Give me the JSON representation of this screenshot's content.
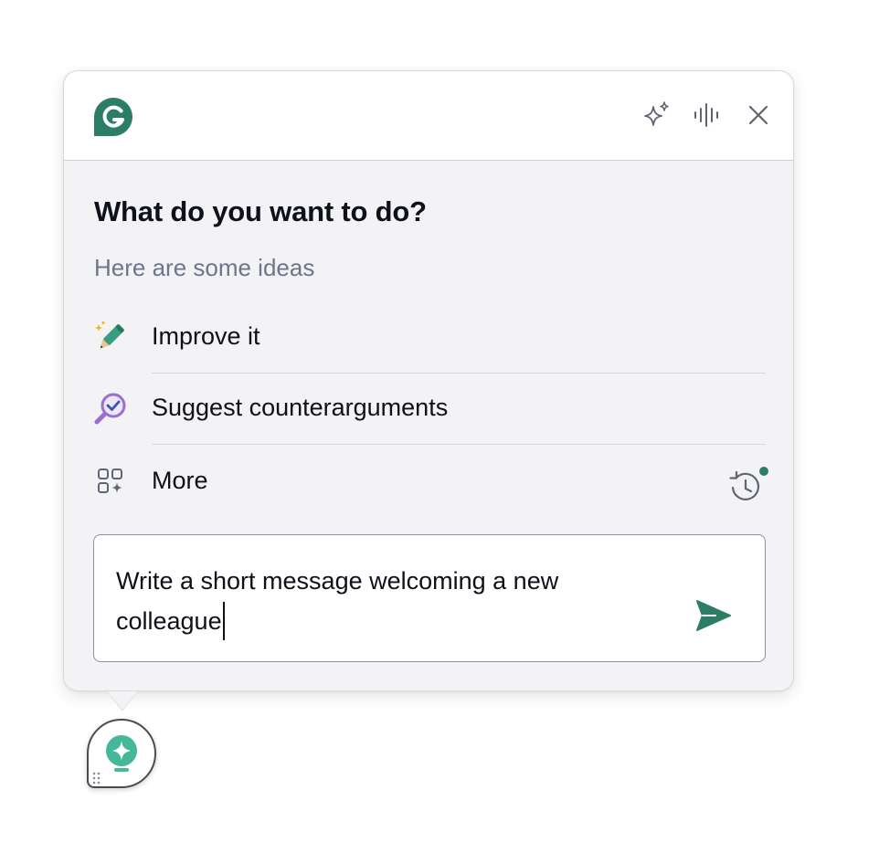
{
  "window": {
    "logo_icon": "grammarly-logo-icon",
    "brand_color": "#2c7d66",
    "header_icons": [
      "sparkle-icon",
      "voice-waveform-icon",
      "close-icon"
    ]
  },
  "prompt_panel": {
    "heading": "What do you want to do?",
    "subheading": "Here are some ideas",
    "ideas": [
      {
        "label": "Improve it",
        "icon": "magic-pencil-icon"
      },
      {
        "label": "Suggest counterarguments",
        "icon": "magnifier-check-icon"
      },
      {
        "label": "More",
        "icon": "apps-grid-sparkle-icon"
      }
    ],
    "history_icon": "history-clock-icon",
    "history_badge_color": "#2c7d66"
  },
  "composer": {
    "value": "Write a short message welcoming a new colleague",
    "send_icon": "send-arrow-icon"
  },
  "floating_button": {
    "icon": "lightbulb-sparkle-icon",
    "grip_icon": "drag-grip-icon"
  }
}
